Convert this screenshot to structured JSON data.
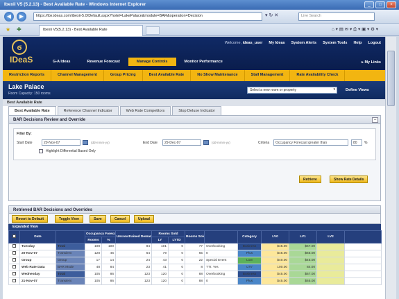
{
  "browser": {
    "title": "Ibexii V5 (5.2.13) - Best Available Rate - Windows Internet Explorer",
    "address": "https://ibx.ideas.com/ibexii-5.0/Default.aspx?hotel=LakePalace&module=BAR&operation=Decision",
    "search_placeholder": "Live Search",
    "tab_title": "Ibexii V5(5.2.13) - Best Available Rate"
  },
  "app": {
    "logo_text": "IDeaS",
    "welcome_prefix": "Welcome,",
    "welcome_user": "ideas_user",
    "top_links": [
      "My Ideas",
      "System Alerts",
      "System Tools",
      "Help",
      "Logout"
    ],
    "main_nav": [
      "G-A Ideas",
      "Revenue Forecast",
      "Manage Controls",
      "Monitor Performance"
    ],
    "main_nav_active": "Manage Controls",
    "my_links": "My Links",
    "sub_nav": [
      "Restriction Reports",
      "Channel Management",
      "Group Pricing",
      "Best Available Rate",
      "No Show Maintenance",
      "Stall Management",
      "Rate Availability Check"
    ]
  },
  "hotel": {
    "name": "Lake Palace",
    "subtitle": "Room Capacity: 150 rooms",
    "select_placeholder": "Select a new room or property",
    "division": "Define Views"
  },
  "page": {
    "section_title": "Best Available Rate",
    "tabs": [
      "Best Available Rate",
      "Reference Channel Indicator",
      "Web Rate Competitors",
      "Stop Deluxe Indicator"
    ],
    "active_tab": "Best Available Rate"
  },
  "review": {
    "title": "BAR Decisions Review and Override",
    "collapse": "–",
    "filter_by": "Filter By:",
    "start_label": "Start Date",
    "start_value": "20-Nov-07",
    "end_label": "End Date",
    "end_value": "29-Dec-07",
    "date_hint": "(dd-mmm-yy)",
    "highlight_label": "Highlight Differential Based Only",
    "criteria_label": "Criteria",
    "criteria_value": "Occupancy Forecast greater than",
    "criteria_num": "80",
    "criteria_unit": "%",
    "retrieve_btn": "Retrieve",
    "show_details_btn": "Show Rate Details"
  },
  "results": {
    "title": "Retrieved BAR Decisions and Overrides",
    "actions": [
      "Revert to Default",
      "Toggle View",
      "Save",
      "Cancel",
      "Upload"
    ],
    "expanded_label": "Expanded View",
    "headers": {
      "date": "Date",
      "segment": "",
      "occ_forecast": "Occupancy Forecast",
      "rooms": "Rooms",
      "pct": "%",
      "unconstrained": "Unconstrained Demand",
      "rooms_sold": "Rooms Sold",
      "ly": "LY",
      "lytd": "LYTD",
      "rooms_sold2": "Rooms Sold",
      "override": "",
      "category": "Category",
      "lv0": "LV0",
      "lv1": "LV1",
      "lv2": "LV2"
    },
    "rows": [
      {
        "date": "Tuesday",
        "segment": "Total",
        "rooms": "108",
        "pct": "100",
        "unc": "84",
        "ly": "101",
        "lytd": "0",
        "sold": "77",
        "override": "Overbooking",
        "category": "Business",
        "lv0": "$45.00",
        "lv1": "$67.00",
        "lv2": "",
        "tone": "dark"
      },
      {
        "date": "20-Nov-07",
        "segment": "Transient",
        "rooms": "128",
        "pct": "46",
        "unc": "64",
        "ly": "79",
        "lytd": "0",
        "sold": "65",
        "override": "0",
        "category": "Plus",
        "lv0": "$45.00",
        "lv1": "$65.00",
        "lv2": "",
        "tone": "blue"
      },
      {
        "date": "Group",
        "segment": "Group",
        "rooms": "17",
        "pct": "14",
        "unc": "24",
        "ly": "43",
        "lytd": "0",
        "sold": "22",
        "override": "Special Event",
        "category": "Low",
        "lv0": "$40.00",
        "lv1": "$45.00",
        "lv2": "",
        "tone": "green"
      },
      {
        "date": "Web Rate Data",
        "segment": "BAR Mode",
        "rooms": "48",
        "pct": "84",
        "unc": "23",
        "ly": "41",
        "lytd": "0",
        "sold": "8",
        "override": "TTI: Yes",
        "category": "LTV",
        "lv0": "100.00",
        "lv1": "84.00",
        "lv2": "",
        "tone": "plain"
      },
      {
        "date": "Wednesday",
        "segment": "Total",
        "rooms": "105",
        "pct": "86",
        "unc": "123",
        "ly": "120",
        "lytd": "0",
        "sold": "88",
        "override": "Overbooking",
        "category": "Business",
        "lv0": "$45.00",
        "lv1": "$67.00",
        "lv2": "",
        "tone": "dark"
      },
      {
        "date": "21-Nov-07",
        "segment": "Transient",
        "rooms": "105",
        "pct": "86",
        "unc": "123",
        "ly": "120",
        "lytd": "0",
        "sold": "88",
        "override": "0",
        "category": "Plus",
        "lv0": "$45.00",
        "lv1": "$65.00",
        "lv2": "",
        "tone": "blue"
      }
    ]
  },
  "colors": {
    "header_navy": "#102a66",
    "accent_gold": "#f2b511",
    "date_red": "#b0282a"
  }
}
